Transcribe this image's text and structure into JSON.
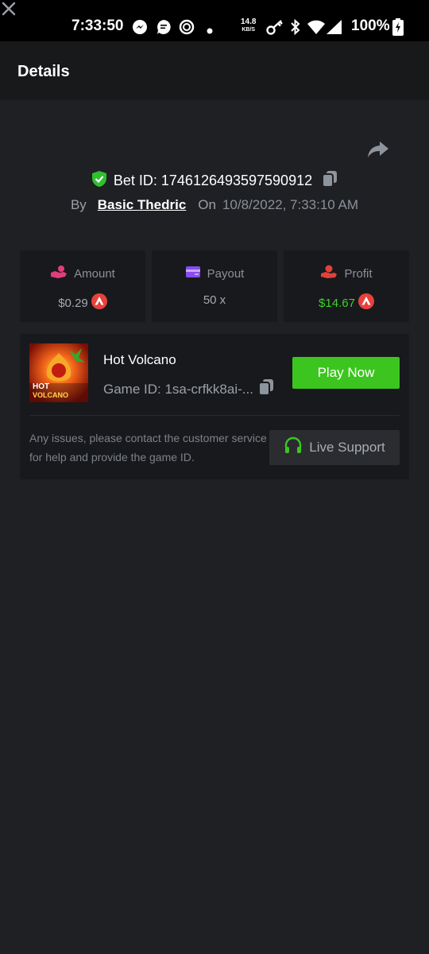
{
  "status_bar": {
    "time": "7:33:50",
    "speed_value": "14.8",
    "speed_unit": "KB/S",
    "battery": "100%"
  },
  "header": {
    "title": "Details"
  },
  "bet": {
    "id_label": "Bet ID: 1746126493597590912",
    "by_label": "By",
    "user": "Basic Thedric",
    "on_label": "On",
    "date": "10/8/2022, 7:33:10 AM"
  },
  "stats": [
    {
      "label": "Amount",
      "value": "$0.29"
    },
    {
      "label": "Payout",
      "value": "50 x"
    },
    {
      "label": "Profit",
      "value": "$14.67"
    }
  ],
  "game": {
    "name": "Hot Volcano",
    "id_text": "Game ID: 1sa-crfkk8ai-...",
    "thumb_line1": "HOT",
    "thumb_line2": "VOLCANO",
    "play_label": "Play Now",
    "notice": "Any issues, please contact the customer service for help and provide the game ID.",
    "support_label": "Live Support"
  },
  "colors": {
    "accent_green": "#3cc51f",
    "profit_green": "#3fd12d",
    "currency_red": "#e8413d",
    "amount_pink": "#e23c7a",
    "payout_purple": "#8a4bf0",
    "profit_red": "#e2413a"
  },
  "icons": [
    "messenger-icon",
    "chat-icon",
    "o-ring-icon",
    "key-icon",
    "bluetooth-icon",
    "wifi-icon",
    "signal-icon",
    "battery-icon",
    "close-icon",
    "share-icon",
    "shield-check-icon",
    "copy-icon",
    "hand-coins-icon",
    "wallet-card-icon",
    "hand-heart-icon",
    "avax-currency-icon",
    "headset-icon"
  ]
}
